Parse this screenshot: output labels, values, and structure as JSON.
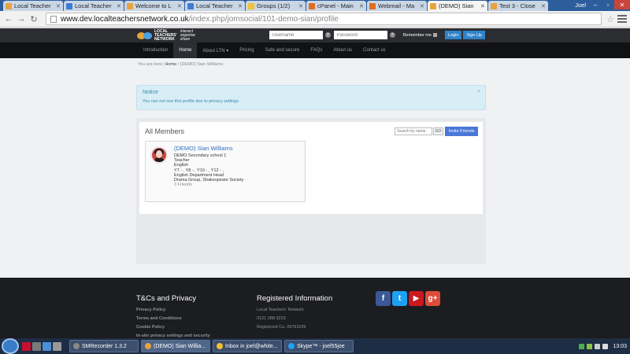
{
  "browser": {
    "tabs": [
      {
        "label": "Local Teacher",
        "favicon_color": "#e8a33d",
        "active": false
      },
      {
        "label": "Local Teacher",
        "favicon_color": "#3d7dd8",
        "active": false
      },
      {
        "label": "Welcome to L",
        "favicon_color": "#e8a33d",
        "active": false
      },
      {
        "label": "Local Teacher",
        "favicon_color": "#3d7dd8",
        "active": false
      },
      {
        "label": "Groups (1/2)",
        "favicon_color": "#f1c232",
        "active": false
      },
      {
        "label": "cPanel - Main",
        "favicon_color": "#e06c1f",
        "active": false
      },
      {
        "label": "Webmail - Ma",
        "favicon_color": "#e06c1f",
        "active": false
      },
      {
        "label": "(DEMO) Sian",
        "favicon_color": "#e8a33d",
        "active": true
      },
      {
        "label": "Test 3 - Close",
        "favicon_color": "#e8a33d",
        "active": false
      }
    ],
    "user": "Joel",
    "url_host": "www.dev.localteachersnetwork.co.uk",
    "url_path": "/index.php/jomsocial/101-demo-sian/profile"
  },
  "site": {
    "logo_text_1": "LOCAL",
    "logo_text_2": "TEACHERS'",
    "logo_text_3": "NETWORK",
    "tagline_1": "interact",
    "tagline_2": "organise",
    "tagline_3": "share",
    "username_placeholder": "Username",
    "password_placeholder": "Password",
    "remember_label": "Remember me",
    "login_label": "Login",
    "signup_label": "Sign Up"
  },
  "nav": [
    {
      "label": "Introduction",
      "active": false
    },
    {
      "label": "Home",
      "active": true
    },
    {
      "label": "About LTN ▾",
      "active": false
    },
    {
      "label": "Pricing",
      "active": false
    },
    {
      "label": "Safe and secure",
      "active": false
    },
    {
      "label": "FAQs",
      "active": false
    },
    {
      "label": "About us",
      "active": false
    },
    {
      "label": "Contact us",
      "active": false
    }
  ],
  "breadcrumb": {
    "prefix": "You are here:",
    "home": "Home",
    "sep": "/",
    "current": "(DEMO) Sian Williams"
  },
  "notice": {
    "title": "Notice",
    "message": "You can not see this profile due to privacy settings",
    "close": "×"
  },
  "members": {
    "title": "All Members",
    "search_placeholder": "Search by name",
    "go_label": "GO",
    "invite_label": "Invite Friends",
    "card": {
      "name": "(DEMO) Sian Williams",
      "lines": [
        "DEMO Secondary school 1",
        "Teacher",
        "English",
        "Y7 - , Y8 - , Y10 - , Y12 - ,",
        "English Department Head",
        "Drama Group, Shakespeare Society"
      ],
      "friends": "3 Friends"
    }
  },
  "footer": {
    "tc_title": "T&Cs and Privacy",
    "tc_links": [
      "Privacy Policy",
      "Terms and Conditions",
      "Cookie Policy",
      "In-site privacy settings and security"
    ],
    "reg_title": "Registered Information",
    "reg_lines": [
      "Local Teachers' Network",
      "0121 288 3223",
      "Registered Co. 09791199"
    ],
    "social": [
      {
        "icon": "facebook-icon",
        "glyph": "f",
        "color": "#3b5998"
      },
      {
        "icon": "twitter-icon",
        "glyph": "t",
        "color": "#1da1f2"
      },
      {
        "icon": "youtube-icon",
        "glyph": "▶",
        "color": "#cc181e"
      },
      {
        "icon": "google-plus-icon",
        "glyph": "g+",
        "color": "#dd4b39"
      }
    ]
  },
  "taskbar": {
    "items": [
      {
        "label": "SMRecorder 1.3.2",
        "color": "#888",
        "active": false
      },
      {
        "label": "(DEMO) Sian Willia...",
        "color": "#e8a33d",
        "active": true
      },
      {
        "label": "Inbox in joel@white...",
        "color": "#f1c232",
        "active": false
      },
      {
        "label": "Skype™ - joel55joe",
        "color": "#1da1f2",
        "active": false
      }
    ],
    "clock": "13:03"
  }
}
